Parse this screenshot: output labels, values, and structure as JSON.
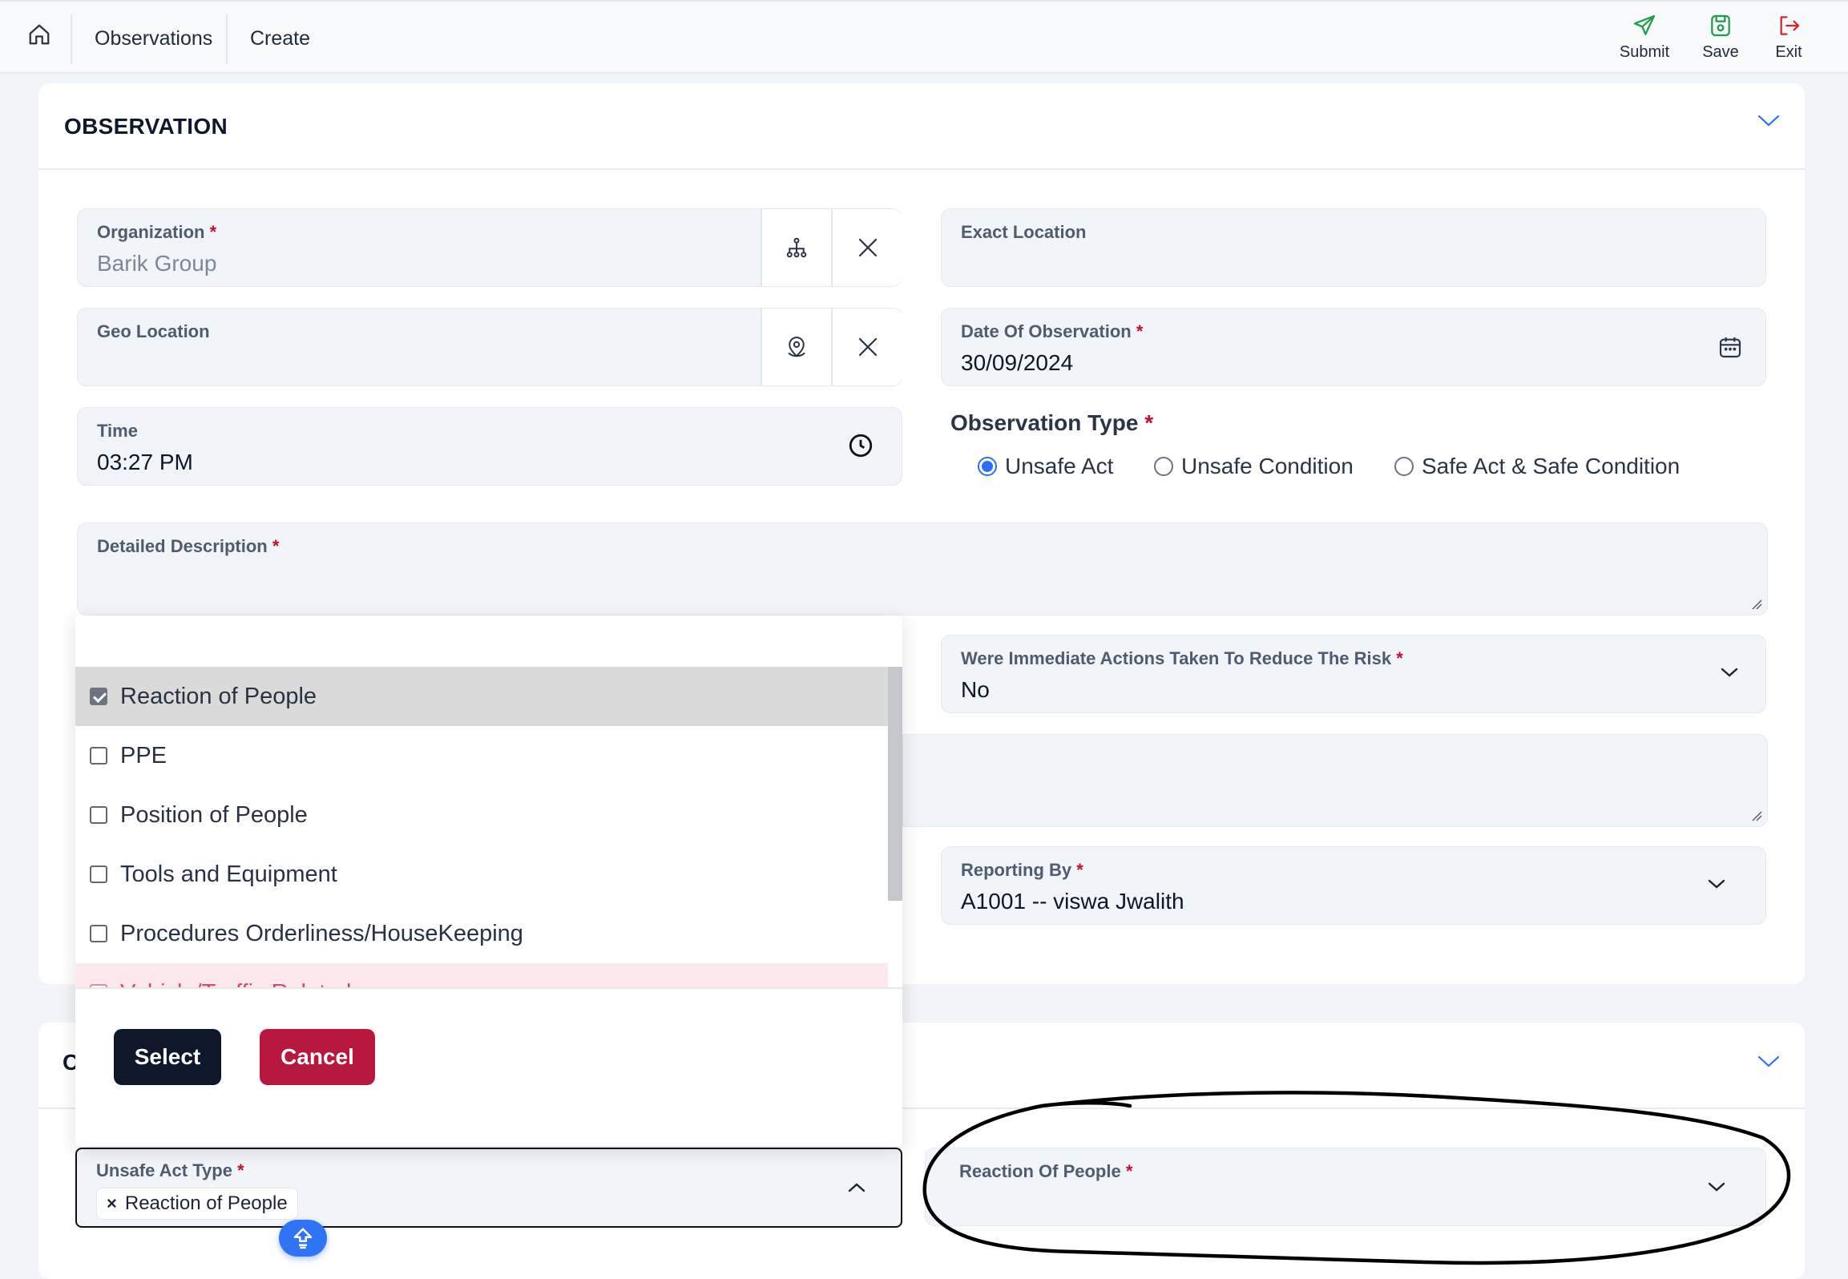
{
  "breadcrumb": {
    "items": [
      "Observations",
      "Create"
    ]
  },
  "toolbar": {
    "submit_label": "Submit",
    "save_label": "Save",
    "exit_label": "Exit"
  },
  "section": {
    "title": "OBSERVATION",
    "second_title_partial": "C"
  },
  "fields": {
    "organization": {
      "label": "Organization",
      "required": "*",
      "value": "Barik Group"
    },
    "exact_location": {
      "label": "Exact Location"
    },
    "geo_location": {
      "label": "Geo Location"
    },
    "date_of_observation": {
      "label": "Date Of Observation",
      "required": "*",
      "value": "30/09/2024"
    },
    "time": {
      "label": "Time",
      "value": "03:27 PM"
    },
    "observation_type": {
      "label": "Observation Type",
      "required": "*",
      "options": [
        "Unsafe Act",
        "Unsafe Condition",
        "Safe Act & Safe Condition"
      ],
      "selected": "Unsafe Act"
    },
    "detailed_description": {
      "label": "Detailed Description",
      "required": "*"
    },
    "immediate_actions": {
      "label": "Were Immediate Actions Taken To Reduce The Risk",
      "required": "*",
      "value": "No"
    },
    "reporting_by": {
      "label": "Reporting By",
      "required": "*",
      "value": "A1001 -- viswa Jwalith"
    },
    "unsafe_act_type": {
      "label": "Unsafe Act Type",
      "required": "*",
      "chip": "Reaction of People"
    },
    "reaction_of_people": {
      "label": "Reaction Of People",
      "required": "*"
    }
  },
  "dropdown": {
    "options": [
      {
        "label": "Reaction of People",
        "checked": true
      },
      {
        "label": "PPE",
        "checked": false
      },
      {
        "label": "Position of People",
        "checked": false
      },
      {
        "label": "Tools and Equipment",
        "checked": false
      },
      {
        "label": "Procedures Orderliness/HouseKeeping",
        "checked": false
      },
      {
        "label": "Vehicle/Traffic Related",
        "checked": false
      }
    ],
    "select_label": "Select",
    "cancel_label": "Cancel"
  },
  "colors": {
    "primary": "#2d6ff0",
    "danger": "#b8183e",
    "dark": "#0f172a",
    "submit_green": "#1e9e4a",
    "exit_red": "#d2252f"
  }
}
